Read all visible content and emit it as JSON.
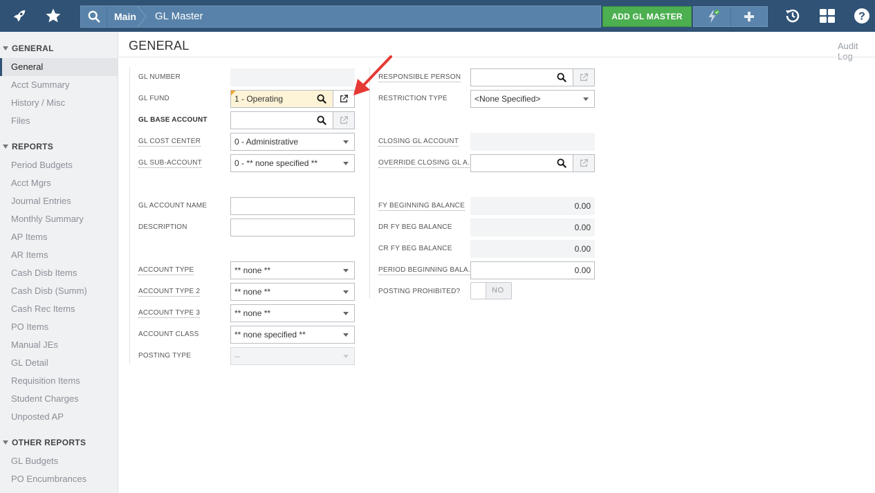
{
  "topbar": {
    "icons": [
      "rocket-icon",
      "star-icon",
      "search-icon",
      "history-icon",
      "dashboard-icon",
      "help-icon"
    ],
    "breadcrumb_main": "Main",
    "breadcrumb_page": "GL Master",
    "add_button": "ADD GL MASTER",
    "colors": {
      "bar": "#2f5275",
      "accent_green": "#4caf50"
    }
  },
  "sidebar": {
    "sections": [
      {
        "title": "GENERAL",
        "items": [
          "General",
          "Acct Summary",
          "History / Misc",
          "Files"
        ],
        "active": "General"
      },
      {
        "title": "REPORTS",
        "items": [
          "Period Budgets",
          "Acct Mgrs",
          "Journal Entries",
          "Monthly Summary",
          "AP Items",
          "AR Items",
          "Cash Disb Items",
          "Cash Disb (Summ)",
          "Cash Rec Items",
          "PO Items",
          "Manual JEs",
          "GL Detail",
          "Requisition Items",
          "Student Charges",
          "Unposted AP"
        ]
      },
      {
        "title": "OTHER REPORTS",
        "items": [
          "GL Budgets",
          "PO Encumbrances"
        ]
      }
    ]
  },
  "main": {
    "title": "GENERAL",
    "audit_log": "Audit Log",
    "left": {
      "gl_number": {
        "label": "GL NUMBER",
        "value": ""
      },
      "gl_fund": {
        "label": "GL FUND",
        "value": "1 - Operating"
      },
      "gl_base_account": {
        "label": "GL BASE ACCOUNT",
        "value": ""
      },
      "gl_cost_center": {
        "label": "GL COST CENTER",
        "value": "0 - Administrative"
      },
      "gl_sub_account": {
        "label": "GL SUB-ACCOUNT",
        "value": "0 - ** none specified **"
      },
      "gl_account_name": {
        "label": "GL ACCOUNT NAME",
        "value": ""
      },
      "description": {
        "label": "DESCRIPTION",
        "value": ""
      },
      "account_type": {
        "label": "ACCOUNT TYPE",
        "value": "** none **"
      },
      "account_type_2": {
        "label": "ACCOUNT TYPE 2",
        "value": "** none **"
      },
      "account_type_3": {
        "label": "ACCOUNT TYPE 3",
        "value": "** none **"
      },
      "account_class": {
        "label": "ACCOUNT CLASS",
        "value": "** none specified **"
      },
      "posting_type": {
        "label": "POSTING TYPE",
        "value": "--"
      }
    },
    "right": {
      "responsible_person": {
        "label": "RESPONSIBLE PERSON",
        "value": ""
      },
      "restriction_type": {
        "label": "RESTRICTION TYPE",
        "value": "<None Specified>"
      },
      "closing_gl_account": {
        "label": "CLOSING GL ACCOUNT",
        "value": ""
      },
      "override_closing": {
        "label": "OVERRIDE CLOSING GL A...",
        "value": ""
      },
      "fy_beginning_balance": {
        "label": "FY BEGINNING BALANCE",
        "value": "0.00"
      },
      "dr_fy_beg_balance": {
        "label": "DR FY BEG BALANCE",
        "value": "0.00"
      },
      "cr_fy_beg_balance": {
        "label": "CR FY BEG BALANCE",
        "value": "0.00"
      },
      "period_beginning_balance": {
        "label": "PERIOD BEGINNING BALA...",
        "value": "0.00"
      },
      "posting_prohibited": {
        "label": "POSTING PROHIBITED?",
        "value": "NO"
      }
    }
  }
}
